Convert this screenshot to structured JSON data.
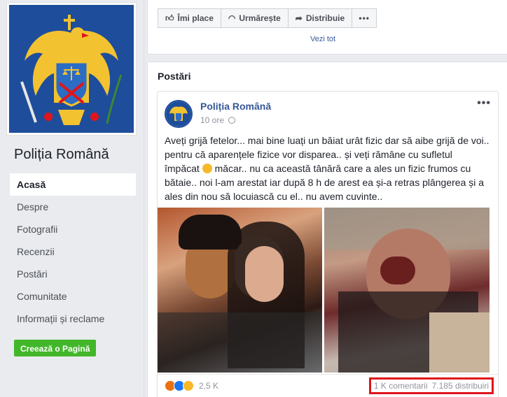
{
  "left": {
    "page_name": "Poliția Română",
    "nav": [
      "Acasă",
      "Despre",
      "Fotografii",
      "Recenzii",
      "Postări",
      "Comunitate",
      "Informații și reclame"
    ],
    "create_page": "Creează o Pagină"
  },
  "top_actions": {
    "like": "Îmi place",
    "follow": "Urmărește",
    "share": "Distribuie",
    "more": "•••",
    "see_all": "Vezi tot"
  },
  "posts": {
    "title": "Postări",
    "post": {
      "author": "Poliția Română",
      "time": "10 ore",
      "text_before_emoji": "Aveți grijă fetelor... mai bine luați un băiat urât fizic dar să aibe grijă de voi.. pentru că aparențele fizice vor disparea.. și veți rămâne cu sufletul împăcat",
      "text_after_emoji": "măcar.. nu ca această tânără care a ales un fizic frumos cu bătaie.. noi l-am arestat iar după 8 h de arest ea și-a retras plângerea și a ales din nou să locuiască cu el.. nu avem cuvinte..",
      "menu": "•••",
      "reaction_count": "2,5 K",
      "comments": "1 K comentarii",
      "shares": "7.185 distribuiri"
    }
  },
  "icons": {
    "like": "thumbs-up-icon",
    "follow": "rss-icon",
    "share": "share-arrow-icon",
    "globe": "globe-icon"
  },
  "colors": {
    "link": "#365899",
    "create_button": "#42b72a",
    "highlight_box": "#e0151b"
  }
}
